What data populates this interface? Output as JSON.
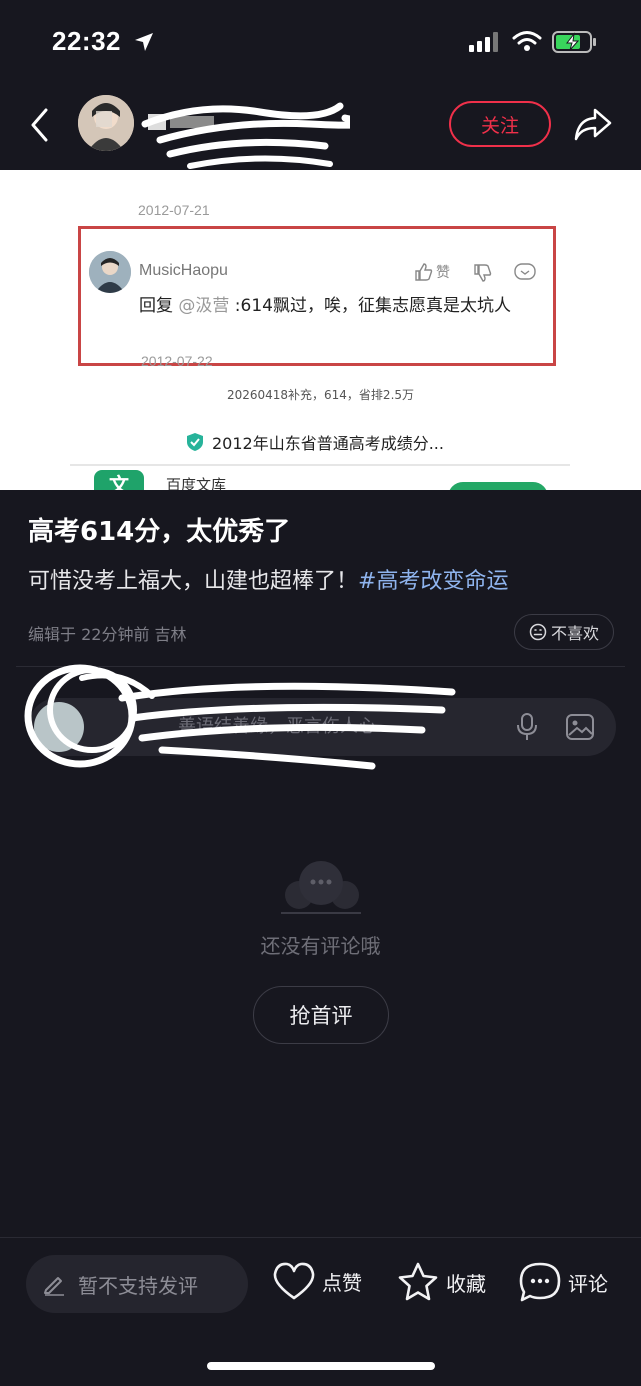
{
  "status_bar": {
    "time": "22:32"
  },
  "nav": {
    "follow_label": "关注"
  },
  "post_image": {
    "date_top": "2012-07-21",
    "author": "MusicHaopu",
    "like_label": "赞",
    "reply_prefix": "回复 ",
    "reply_mention": "@汲营",
    "reply_text": " :614飘过，唉，征集志愿真是太坑人",
    "date_bottom": "2012-07-22",
    "note": "20260418补充，614，省排2.5万",
    "link_text": "2012年山东省普通高考成绩分...",
    "app_icon_char": "文",
    "app_name": "百度文库"
  },
  "post": {
    "title": "高考614分，太优秀了",
    "body": "可惜没考上福大，山建也超棒了！",
    "hashtag": "#高考改变命运",
    "meta": "编辑于 22分钟前 吉林",
    "dislike_label": "不喜欢"
  },
  "comments": {
    "input_placeholder": "善语结善缘，恶言伤人心",
    "empty_text": "还没有评论哦",
    "first_comment_label": "抢首评"
  },
  "bottom_bar": {
    "no_comment_label": "暂不支持发评",
    "like_label": "点赞",
    "collect_label": "收藏",
    "comment_label": "评论"
  },
  "colors": {
    "background": "#17171f",
    "accent_red": "#f0304a",
    "hashtag": "#8fb4ee"
  },
  "icons": [
    "location-arrow-icon",
    "cellular-icon",
    "wifi-icon",
    "battery-charging-icon",
    "back-icon",
    "share-icon",
    "mic-icon",
    "image-icon",
    "comment-bubble-icon",
    "pencil-icon",
    "heart-icon",
    "star-icon",
    "comment-icon"
  ]
}
